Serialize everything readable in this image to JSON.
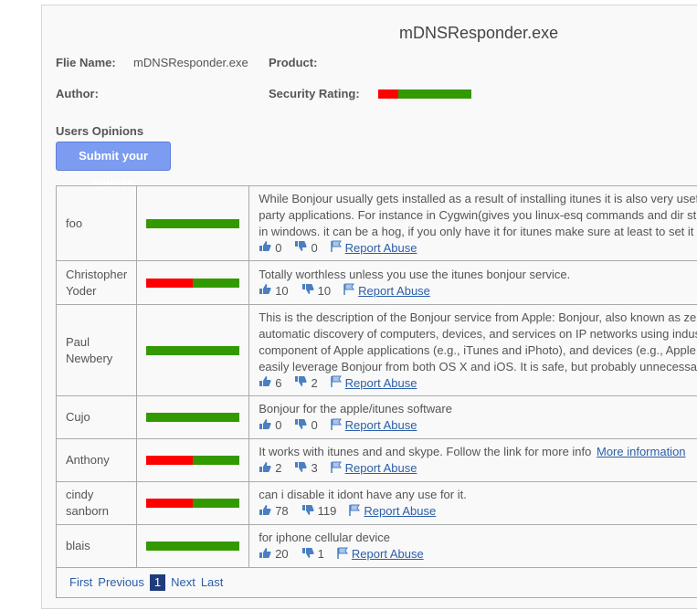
{
  "header": {
    "title": "mDNSResponder.exe",
    "file_name_label": "Flie Name:",
    "file_name_value": "mDNSResponder.exe",
    "product_label": "Product:",
    "author_label": "Author:",
    "security_label": "Security Rating:",
    "security_rating": {
      "bad": 0.22,
      "good": 0.78
    }
  },
  "opinions": {
    "heading": "Users Opinions",
    "submit_label": "Submit your opinion",
    "rows": [
      {
        "name": "foo",
        "rating": {
          "bad": 0.0,
          "good": 1.0
        },
        "lines": [
          "While Bonjour usually gets installed as a result of installing itunes it is also very useful for other",
          "party applications. For instance in Cygwin(gives you linux-esq commands and dir structures",
          "in windows. it can be a hog, if you only have it for itunes make sure at least to set it to manual."
        ],
        "up": "0",
        "down": "0",
        "report": "Report Abuse"
      },
      {
        "name": "Christopher Yoder",
        "rating": {
          "bad": 0.5,
          "good": 0.5
        },
        "lines": [
          "Totally worthless unless you use the itunes bonjour service."
        ],
        "up": "10",
        "down": "10",
        "report": "Report Abuse"
      },
      {
        "name": "Paul Newbery",
        "rating": {
          "bad": 0.0,
          "good": 1.0
        },
        "lines": [
          "This is the description of the Bonjour service from Apple: Bonjour, also known as zero-configuration",
          "automatic discovery of computers, devices, and services on IP networks using industry standard",
          "component of Apple applications (e.g., iTunes and iPhoto), and devices (e.g., Apple TV and AirPort)",
          "easily leverage Bonjour from both OS X and iOS. It is safe, but probably unnecessary."
        ],
        "up": "6",
        "down": "2",
        "report": "Report Abuse"
      },
      {
        "name": "Cujo",
        "rating": {
          "bad": 0.0,
          "good": 1.0
        },
        "lines": [
          "Bonjour for the apple/itunes software"
        ],
        "up": "0",
        "down": "0",
        "report": "Report Abuse"
      },
      {
        "name": "Anthony",
        "rating": {
          "bad": 0.5,
          "good": 0.5
        },
        "lines": [
          "It works with itunes and and skype. Follow the link for more info"
        ],
        "more_info": "More information",
        "up": "2",
        "down": "3",
        "report": "Report Abuse"
      },
      {
        "name": "cindy sanborn",
        "rating": {
          "bad": 0.5,
          "good": 0.5
        },
        "lines": [
          "can i disable it idont have any use for it."
        ],
        "up": "78",
        "down": "119",
        "report": "Report Abuse"
      },
      {
        "name": "blais",
        "rating": {
          "bad": 0.0,
          "good": 1.0
        },
        "lines": [
          "for iphone cellular device"
        ],
        "up": "20",
        "down": "1",
        "report": "Report Abuse"
      }
    ]
  },
  "pager": {
    "first": "First",
    "previous": "Previous",
    "current": "1",
    "next": "Next",
    "last": "Last"
  },
  "colors": {
    "bad": "#ff0000",
    "good": "#339900",
    "link": "#2b5ea8",
    "button": "#7b9cf0"
  },
  "icons": {
    "up": "thumbs-up-icon",
    "down": "thumbs-down-icon",
    "report": "flag-icon"
  }
}
